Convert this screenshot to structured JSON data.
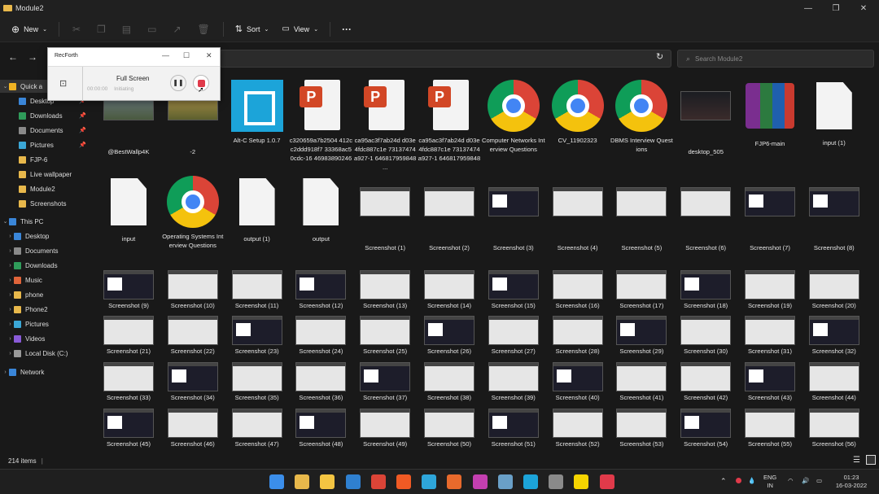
{
  "window": {
    "title": "Module2",
    "minimize": "—",
    "maximize": "❐",
    "close": "✕"
  },
  "toolbar": {
    "new": "New",
    "sort": "Sort",
    "view": "View",
    "more": "···"
  },
  "search": {
    "placeholder": "Search Module2"
  },
  "sidebar": {
    "quick_access": "Quick a",
    "quick_items": [
      "Desktop",
      "Downloads",
      "Documents",
      "Pictures",
      "FJP-6",
      "Live wallpaper",
      "Module2",
      "Screenshots"
    ],
    "this_pc": "This PC",
    "pc_items": [
      "Desktop",
      "Documents",
      "Downloads",
      "Music",
      "phone",
      "Phone2",
      "Pictures",
      "Videos",
      "Local Disk (C:)"
    ],
    "network": "Network"
  },
  "files_row1": [
    {
      "name": "@BestWallp4K",
      "kind": "photo"
    },
    {
      "name": "-2",
      "kind": "photo2"
    },
    {
      "name": "Alt-C Setup 1.0.7",
      "kind": "altc"
    },
    {
      "name": "c320659a7b2504 412cc2ddd918f7 33368ac50cdc-16 46983890246",
      "kind": "ppt"
    },
    {
      "name": "ca95ac3f7ab24d d03e4fdc887c1e 73137474a927-1 646817959848 ...",
      "kind": "ppt"
    },
    {
      "name": "ca95ac3f7ab24d d03e4fdc887c1e 73137474a927-1 646817959848",
      "kind": "ppt"
    },
    {
      "name": "Computer Networks Interview Questions",
      "kind": "chrome"
    },
    {
      "name": "CV_11902323",
      "kind": "chrome"
    },
    {
      "name": "DBMS Interview Questions",
      "kind": "chrome"
    },
    {
      "name": "desktop_505",
      "kind": "night"
    },
    {
      "name": "FJP6-main",
      "kind": "rar"
    },
    {
      "name": "input (1)",
      "kind": "doc"
    }
  ],
  "files_row2": [
    {
      "name": "input",
      "kind": "doc"
    },
    {
      "name": "Operating Systems Interview Questions",
      "kind": "chrome"
    },
    {
      "name": "output (1)",
      "kind": "doc"
    },
    {
      "name": "output",
      "kind": "doc"
    },
    {
      "name": "Screenshot (1)",
      "kind": "shot"
    },
    {
      "name": "Screenshot (2)",
      "kind": "shot"
    },
    {
      "name": "Screenshot (3)",
      "kind": "dark"
    },
    {
      "name": "Screenshot (4)",
      "kind": "shot"
    },
    {
      "name": "Screenshot (5)",
      "kind": "shot"
    },
    {
      "name": "Screenshot (6)",
      "kind": "shot"
    },
    {
      "name": "Screenshot (7)",
      "kind": "dark"
    },
    {
      "name": "Screenshot (8)",
      "kind": "dark"
    }
  ],
  "screenshot_rows": [
    [
      "Screenshot (9)",
      "Screenshot (10)",
      "Screenshot (11)",
      "Screenshot (12)",
      "Screenshot (13)",
      "Screenshot (14)",
      "Screenshot (15)",
      "Screenshot (16)",
      "Screenshot (17)",
      "Screenshot (18)",
      "Screenshot (19)",
      "Screenshot (20)"
    ],
    [
      "Screenshot (21)",
      "Screenshot (22)",
      "Screenshot (23)",
      "Screenshot (24)",
      "Screenshot (25)",
      "Screenshot (26)",
      "Screenshot (27)",
      "Screenshot (28)",
      "Screenshot (29)",
      "Screenshot (30)",
      "Screenshot (31)",
      "Screenshot (32)"
    ],
    [
      "Screenshot (33)",
      "Screenshot (34)",
      "Screenshot (35)",
      "Screenshot (36)",
      "Screenshot (37)",
      "Screenshot (38)",
      "Screenshot (39)",
      "Screenshot (40)",
      "Screenshot (41)",
      "Screenshot (42)",
      "Screenshot (43)",
      "Screenshot (44)"
    ],
    [
      "Screenshot (45)",
      "Screenshot (46)",
      "Screenshot (47)",
      "Screenshot (48)",
      "Screenshot (49)",
      "Screenshot (50)",
      "Screenshot (51)",
      "Screenshot (52)",
      "Screenshot (53)",
      "Screenshot (54)",
      "Screenshot (55)",
      "Screenshot (56)"
    ]
  ],
  "status": {
    "count": "214 items"
  },
  "recorder": {
    "title": "RecForth",
    "mode": "Full Screen",
    "time": "00:00:00",
    "state": "Initiating"
  },
  "tray": {
    "lang": "ENG",
    "region": "IN",
    "time": "01:23",
    "date": "16-03-2022"
  },
  "taskbar_apps": [
    {
      "name": "start-icon",
      "color": "#3b8eea"
    },
    {
      "name": "store-icon",
      "color": "#e8b84b"
    },
    {
      "name": "file-explorer-icon",
      "color": "#f4c542"
    },
    {
      "name": "vscode-icon",
      "color": "#2f80d0"
    },
    {
      "name": "chrome-icon",
      "color": "#db4437"
    },
    {
      "name": "brave-icon",
      "color": "#f05a24"
    },
    {
      "name": "telegram-icon",
      "color": "#2ea6da"
    },
    {
      "name": "quillbot-icon",
      "color": "#e86a2c"
    },
    {
      "name": "photos-icon",
      "color": "#c43fb0"
    },
    {
      "name": "gallery-icon",
      "color": "#6aa0c8"
    },
    {
      "name": "altc-icon",
      "color": "#1ca4d9"
    },
    {
      "name": "settings-icon",
      "color": "#8a8a8a"
    },
    {
      "name": "sticky-notes-icon",
      "color": "#f5d400"
    },
    {
      "name": "recforth-icon",
      "color": "#e03a4a"
    }
  ]
}
